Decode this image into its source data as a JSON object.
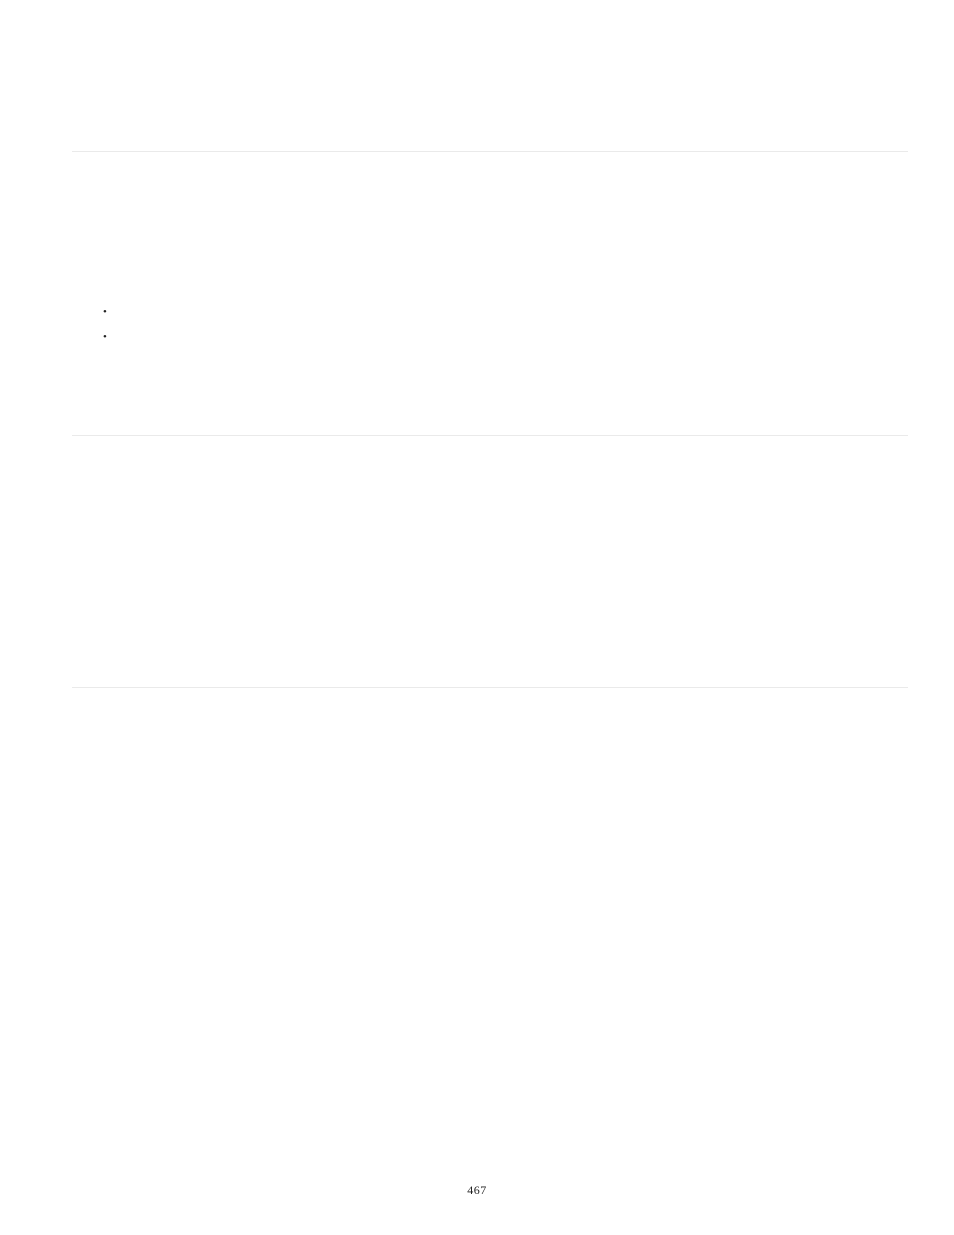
{
  "page": {
    "number": "467"
  },
  "bullets": {
    "dot": "•"
  }
}
